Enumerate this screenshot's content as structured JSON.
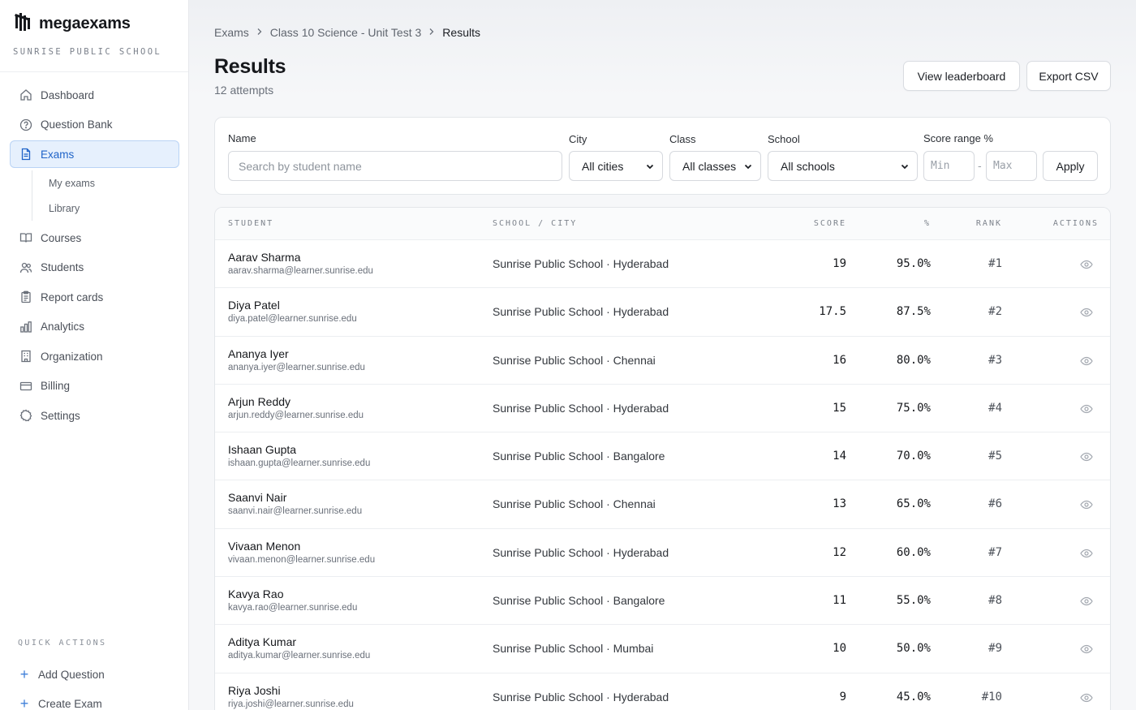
{
  "brand": {
    "name": "megaexams",
    "school": "SUNRISE PUBLIC SCHOOL"
  },
  "nav": {
    "dashboard": "Dashboard",
    "question_bank": "Question Bank",
    "exams": "Exams",
    "my_exams": "My exams",
    "library": "Library",
    "courses": "Courses",
    "students": "Students",
    "report_cards": "Report cards",
    "analytics": "Analytics",
    "organization": "Organization",
    "billing": "Billing",
    "settings": "Settings"
  },
  "quick_actions": {
    "title": "QUICK ACTIONS",
    "add_question": "Add Question",
    "create_exam": "Create Exam"
  },
  "breadcrumb": {
    "root": "Exams",
    "exam": "Class 10 Science - Unit Test 3",
    "current": "Results"
  },
  "page": {
    "title": "Results",
    "subtitle": "12 attempts"
  },
  "actions": {
    "leaderboard": "View leaderboard",
    "export": "Export CSV"
  },
  "filters": {
    "name_label": "Name",
    "name_placeholder": "Search by student name",
    "city_label": "City",
    "city_value": "All cities",
    "class_label": "Class",
    "class_value": "All classes",
    "school_label": "School",
    "school_value": "All schools",
    "score_label": "Score range %",
    "min_placeholder": "Min",
    "max_placeholder": "Max",
    "dash": "-",
    "apply": "Apply"
  },
  "table": {
    "headers": {
      "student": "STUDENT",
      "school_city": "SCHOOL / CITY",
      "score": "SCORE",
      "percent": "%",
      "rank": "RANK",
      "actions": "ACTIONS"
    },
    "rows": [
      {
        "name": "Aarav Sharma",
        "email": "aarav.sharma@learner.sunrise.edu",
        "school": "Sunrise Public School · Hyderabad",
        "score": "19",
        "percent": "95.0%",
        "rank": "#1"
      },
      {
        "name": "Diya Patel",
        "email": "diya.patel@learner.sunrise.edu",
        "school": "Sunrise Public School · Hyderabad",
        "score": "17.5",
        "percent": "87.5%",
        "rank": "#2"
      },
      {
        "name": "Ananya Iyer",
        "email": "ananya.iyer@learner.sunrise.edu",
        "school": "Sunrise Public School · Chennai",
        "score": "16",
        "percent": "80.0%",
        "rank": "#3"
      },
      {
        "name": "Arjun Reddy",
        "email": "arjun.reddy@learner.sunrise.edu",
        "school": "Sunrise Public School · Hyderabad",
        "score": "15",
        "percent": "75.0%",
        "rank": "#4"
      },
      {
        "name": "Ishaan Gupta",
        "email": "ishaan.gupta@learner.sunrise.edu",
        "school": "Sunrise Public School · Bangalore",
        "score": "14",
        "percent": "70.0%",
        "rank": "#5"
      },
      {
        "name": "Saanvi Nair",
        "email": "saanvi.nair@learner.sunrise.edu",
        "school": "Sunrise Public School · Chennai",
        "score": "13",
        "percent": "65.0%",
        "rank": "#6"
      },
      {
        "name": "Vivaan Menon",
        "email": "vivaan.menon@learner.sunrise.edu",
        "school": "Sunrise Public School · Hyderabad",
        "score": "12",
        "percent": "60.0%",
        "rank": "#7"
      },
      {
        "name": "Kavya Rao",
        "email": "kavya.rao@learner.sunrise.edu",
        "school": "Sunrise Public School · Bangalore",
        "score": "11",
        "percent": "55.0%",
        "rank": "#8"
      },
      {
        "name": "Aditya Kumar",
        "email": "aditya.kumar@learner.sunrise.edu",
        "school": "Sunrise Public School · Mumbai",
        "score": "10",
        "percent": "50.0%",
        "rank": "#9"
      },
      {
        "name": "Riya Joshi",
        "email": "riya.joshi@learner.sunrise.edu",
        "school": "Sunrise Public School · Hyderabad",
        "score": "9",
        "percent": "45.0%",
        "rank": "#10"
      }
    ]
  },
  "colors": {
    "accent": "#1f63c8",
    "active_bg": "#e6f0fd",
    "border": "#e3e6ea"
  }
}
